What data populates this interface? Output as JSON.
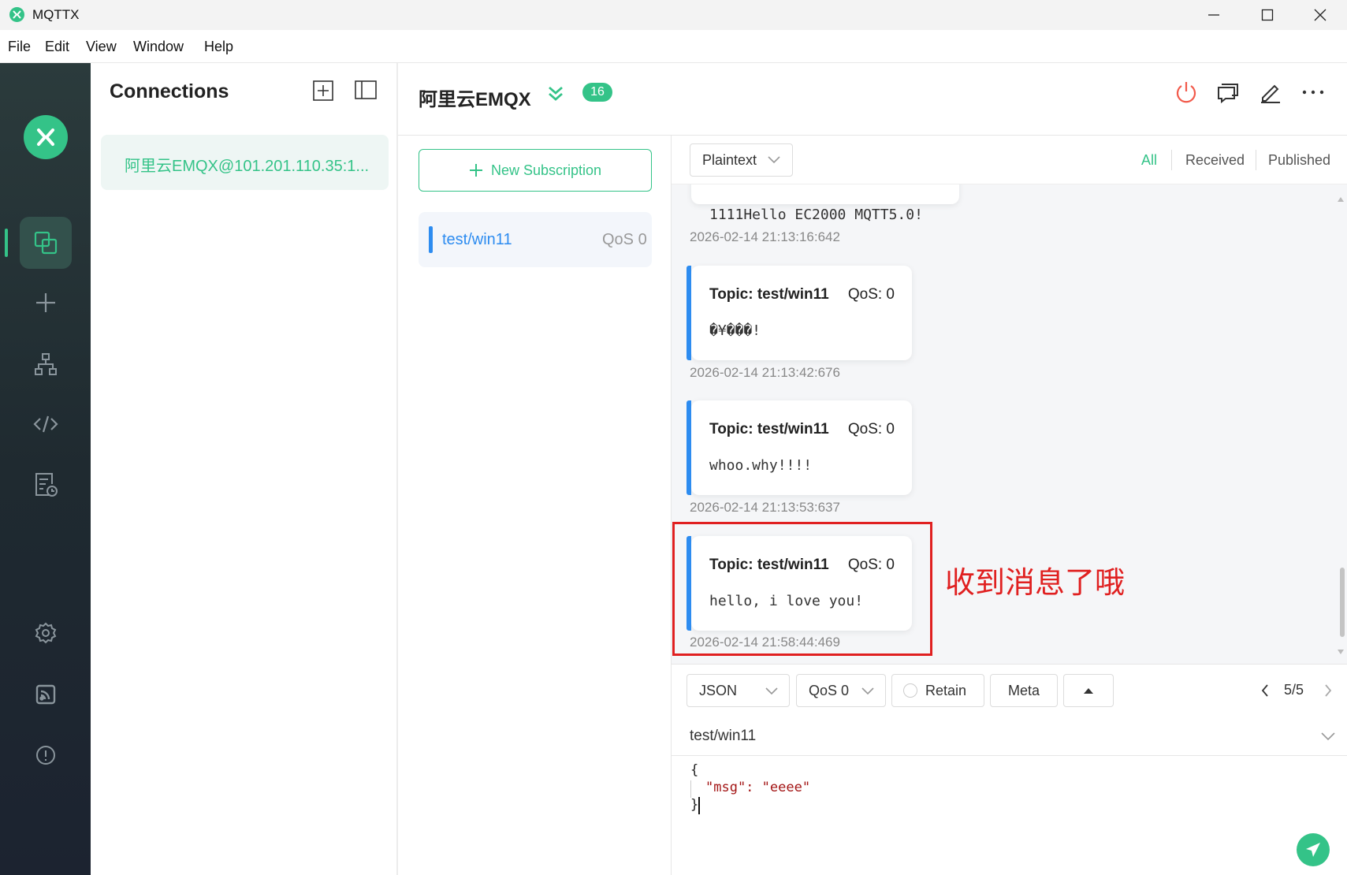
{
  "window": {
    "title": "MQTTX"
  },
  "menu": [
    "File",
    "Edit",
    "View",
    "Window",
    "Help"
  ],
  "connections": {
    "heading": "Connections",
    "items": [
      {
        "label": "阿里云EMQX@101.201.110.35:1..."
      }
    ]
  },
  "connection": {
    "name": "阿里云EMQX",
    "badge": "16"
  },
  "subscriptions": {
    "new_label": "New Subscription",
    "items": [
      {
        "topic": "test/win11",
        "qos": "QoS 0",
        "color": "#2d8cf0"
      }
    ]
  },
  "messages_toolbar": {
    "format": "Plaintext",
    "filters": [
      "All",
      "Received",
      "Published"
    ],
    "active_filter": "All"
  },
  "messages": [
    {
      "payload": "1111Hello EC2000 MQTT5.0!",
      "time": "2026-02-14 21:13:16:642"
    },
    {
      "topic": "Topic: test/win11",
      "qos": "QoS: 0",
      "payload": "�¥���!",
      "time": "2026-02-14 21:13:42:676"
    },
    {
      "topic": "Topic: test/win11",
      "qos": "QoS: 0",
      "payload": "whoo.why!!!!",
      "time": "2026-02-14 21:13:53:637"
    },
    {
      "topic": "Topic: test/win11",
      "qos": "QoS: 0",
      "payload": "hello, i love you!",
      "time": "2026-02-14 21:58:44:469"
    }
  ],
  "annotation": {
    "text": "收到消息了哦",
    "color": "#e02020"
  },
  "publish": {
    "format": "JSON",
    "qos": "QoS 0",
    "retain_label": "Retain",
    "meta_label": "Meta",
    "page": "5/5",
    "topic": "test/win11",
    "payload_lines": [
      "{",
      "\"msg\": \"eeee\"",
      "}"
    ]
  },
  "colors": {
    "accent": "#34c388",
    "blue": "#2d8cf0",
    "red": "#e02020",
    "sidebar": "#233034"
  }
}
